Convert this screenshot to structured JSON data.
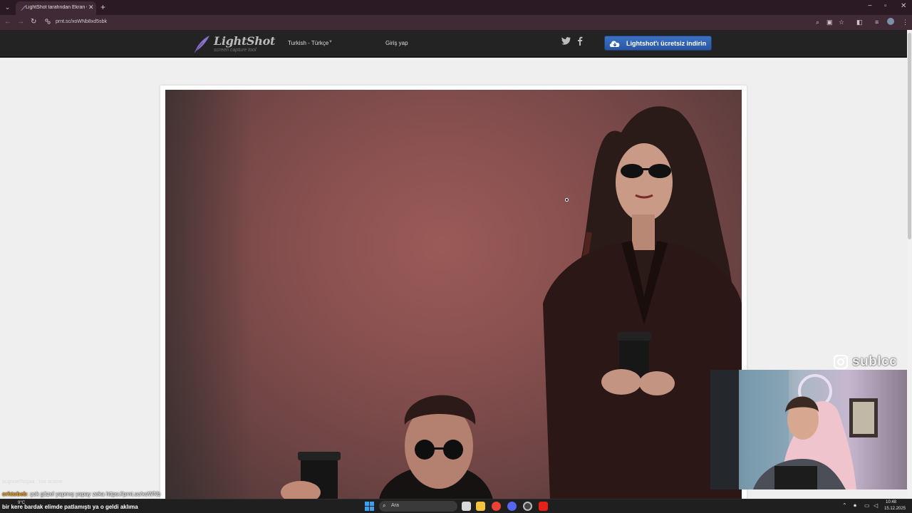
{
  "browser": {
    "tab": {
      "title": "LightShot tarafından Ekran Görüntüsü",
      "close": "✕"
    },
    "new_tab": "+",
    "url": "prnt.sc/xoWNb8xd5sbk",
    "window_controls": {
      "minimize": "−",
      "maximize": "▫",
      "close": "✕"
    }
  },
  "site": {
    "logo": "LightShot",
    "tagline": "screen capture tool",
    "language": "Turkish - Türkçe",
    "login": "Giriş yap",
    "download_button": "Lightshot'ı ücretsiz indirin",
    "social": [
      "twitter-icon",
      "facebook-icon"
    ]
  },
  "overlay": {
    "instagram_handle": "sublcc",
    "chat_faded": "bugunelTolgaa : tisk dusme",
    "chat_line1_user": "orhtobeb",
    "chat_line1_text": ": çok güzel yapmış yapay zeka https://prnt.sc/xoWNb",
    "chat_line2_user": "",
    "chat_line2_text": "bir kere bardak elimde patlamıştı ya o geldi aklıma"
  },
  "taskbar": {
    "weather": "9°C",
    "search_placeholder": "Ara",
    "time": "10:48",
    "date": "15.12.2025"
  },
  "colors": {
    "header_bg": "#232323",
    "download_button": "#2f5fb0",
    "page_bg": "#efefef"
  }
}
